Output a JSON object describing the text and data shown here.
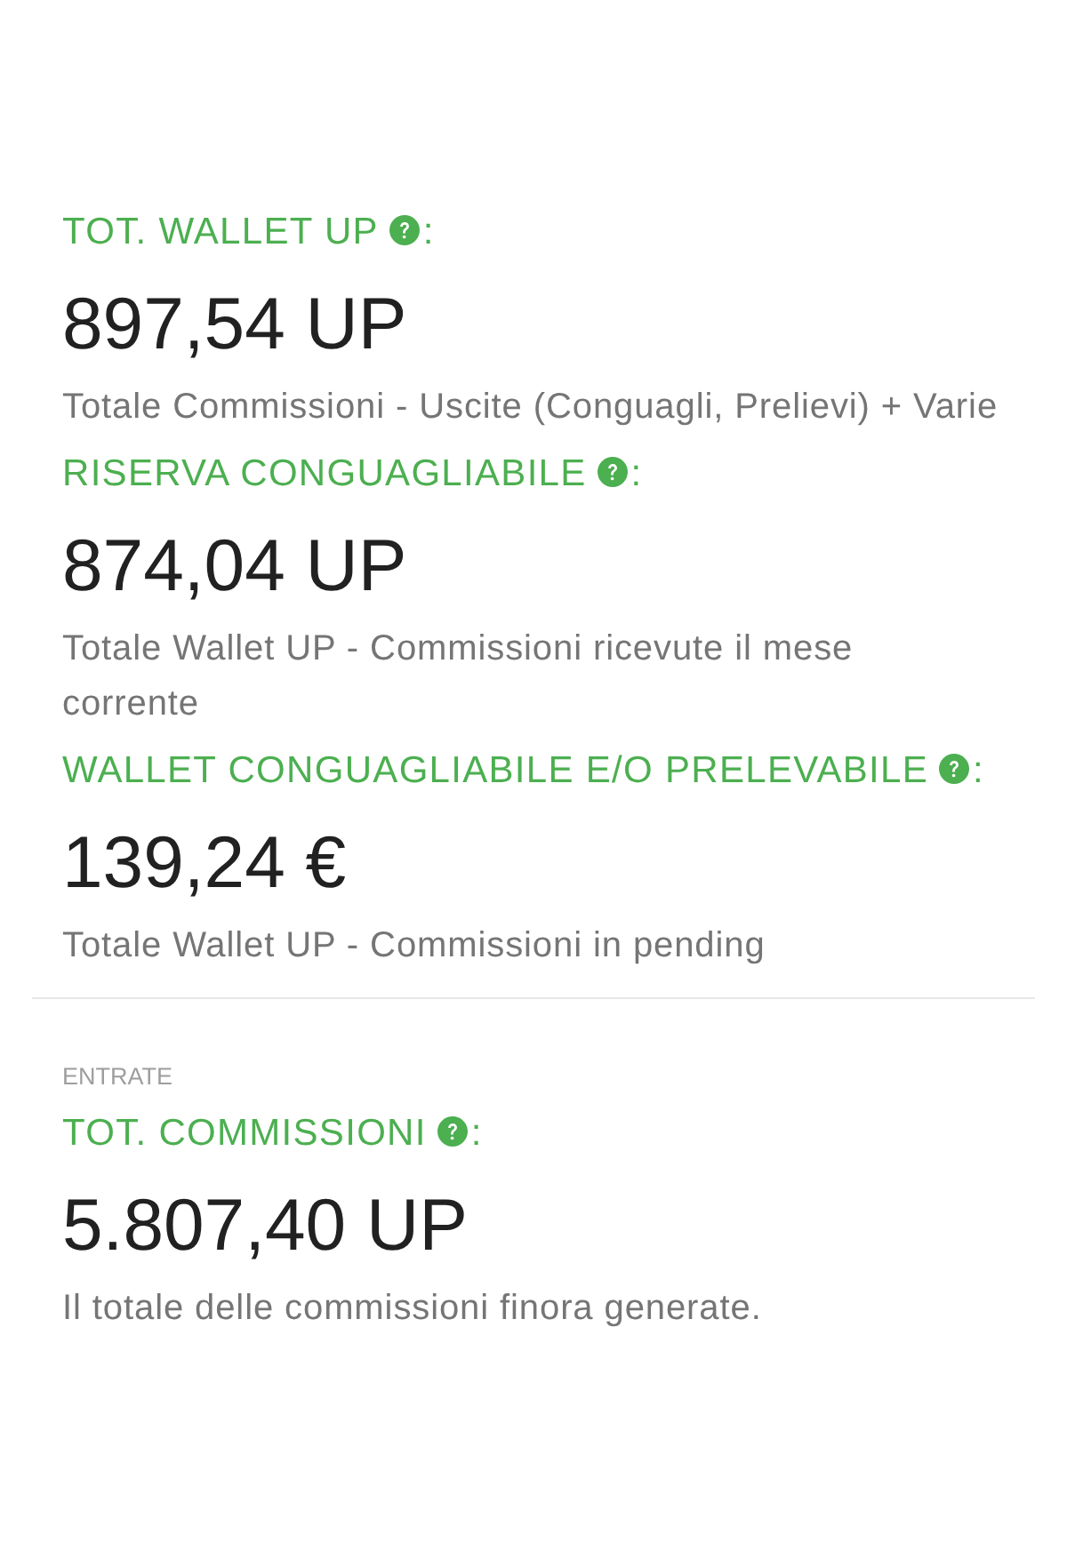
{
  "groups": [
    {
      "items": [
        {
          "label": "TOT. WALLET UP",
          "suffix": ":",
          "help": true,
          "value": "897,54 UP",
          "description": "Totale Commissioni - Uscite (Conguagli, Prelievi) + Varie"
        },
        {
          "label": "RISERVA CONGUAGLIABILE",
          "suffix": ":",
          "help": true,
          "value": "874,04 UP",
          "description": "Totale Wallet UP - Commissioni ricevute il mese corrente"
        },
        {
          "label": "WALLET CONGUAGLIABILE E/O PRELEVABILE",
          "suffix": ":",
          "help": true,
          "value": "139,24 €",
          "description": "Totale Wallet UP - Commissioni in pending"
        }
      ]
    },
    {
      "header": "ENTRATE",
      "items": [
        {
          "label": "TOT. COMMISSIONI",
          "suffix": ":",
          "help": true,
          "value": "5.807,40 UP",
          "description": "Il totale delle commissioni finora generate."
        }
      ]
    }
  ]
}
